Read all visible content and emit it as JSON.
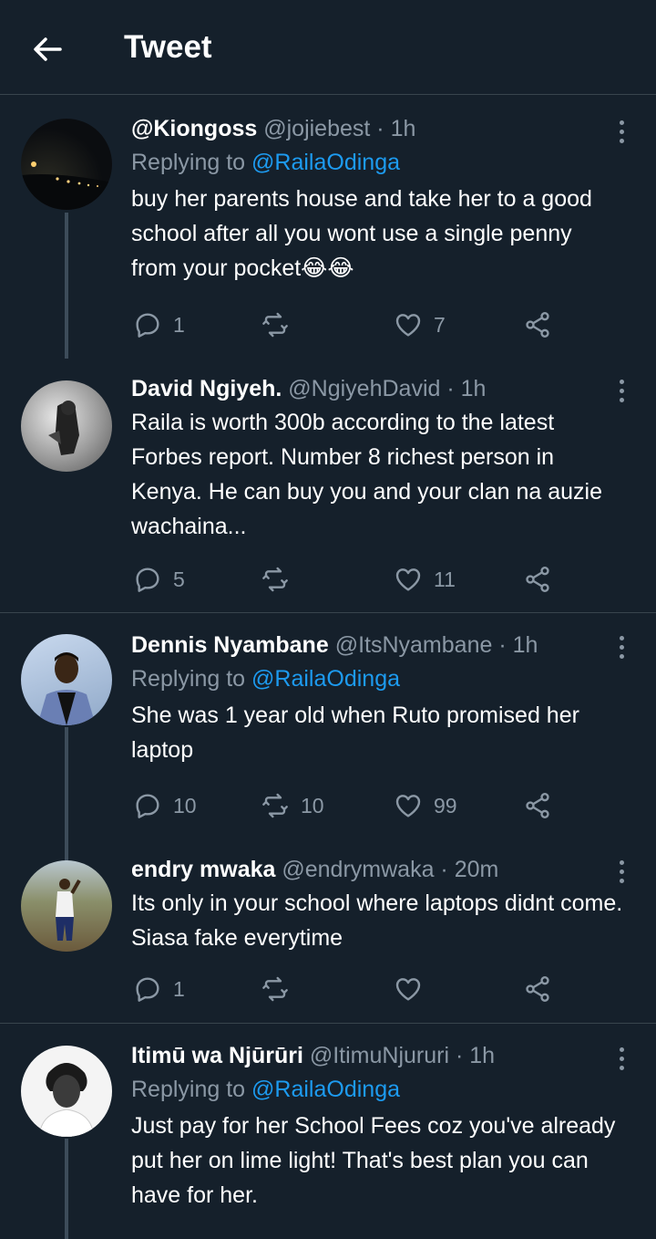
{
  "header": {
    "title": "Tweet"
  },
  "tweets": [
    {
      "name": "@Kiongoss",
      "handle": "@jojiebest",
      "time": "1h",
      "replying_label": "Replying to",
      "replying_to": "@RailaOdinga",
      "text": "buy her parents house and take her to a good school after all you wont use a single penny from your pocket😂😂",
      "replies": "1",
      "retweets": "",
      "likes": "7"
    },
    {
      "name": "David Ngiyeh.",
      "handle": "@NgiyehDavid",
      "time": "1h",
      "text": "Raila is worth 300b according to the latest Forbes report. Number 8 richest person in Kenya. He can buy you and your clan na auzie wachaina...",
      "replies": "5",
      "retweets": "",
      "likes": "11"
    },
    {
      "name": "Dennis Nyambane",
      "handle": "@ItsNyambane",
      "time": "1h",
      "replying_label": "Replying to",
      "replying_to": "@RailaOdinga",
      "text": "She was 1 year old when Ruto promised her laptop",
      "replies": "10",
      "retweets": "10",
      "likes": "99"
    },
    {
      "name": "endry mwaka",
      "handle": "@endrymwaka",
      "time": "20m",
      "text": "Its only in your school where laptops didnt come. Siasa fake everytime",
      "replies": "1",
      "retweets": "",
      "likes": ""
    },
    {
      "name": "Itimū wa Njūrūri",
      "handle": "@ItimuNjururi",
      "time": "1h",
      "replying_label": "Replying to",
      "replying_to": "@RailaOdinga",
      "text": "Just pay for her School Fees coz you've already put her on lime light! That's best plan you can have for her."
    }
  ],
  "separator": " · ",
  "colors": {
    "background": "#15202b",
    "accent": "#1d9bf0",
    "muted": "#8b98a5",
    "divider": "#38444d"
  },
  "icons": [
    "back-arrow-icon",
    "more-vertical-icon",
    "reply-icon",
    "retweet-icon",
    "like-icon",
    "share-icon"
  ]
}
